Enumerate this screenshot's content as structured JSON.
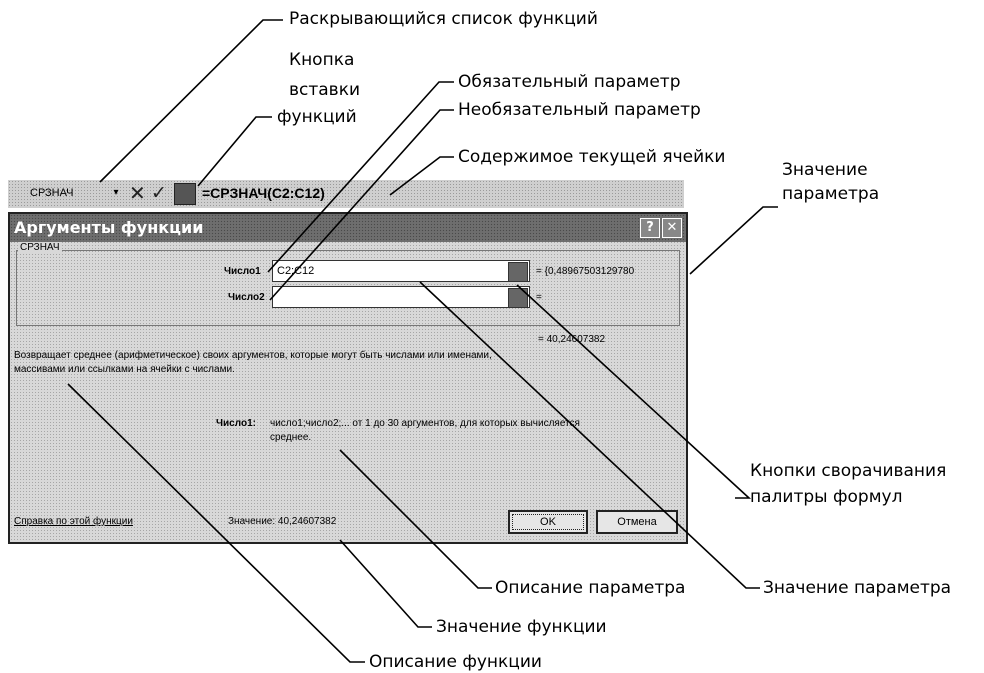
{
  "annotations": {
    "function_list": "Раскрывающийся список функций",
    "insert_button_l1": "Кнопка",
    "insert_button_l2": "вставки",
    "insert_button_l3": "функций",
    "required_param": "Обязательный параметр",
    "optional_param": "Необязательный параметр",
    "cell_contents": "Содержимое текущей ячейки",
    "param_value_top_l1": "Значение",
    "param_value_top_l2": "параметра",
    "collapse_buttons_l1": "Кнопки сворачивания",
    "collapse_buttons_l2": "палитры формул",
    "param_description": "Описание параметра",
    "param_value_bottom": "Значение параметра",
    "function_value": "Значение функции",
    "function_description": "Описание функции"
  },
  "formula_bar": {
    "name_box": "СРЗНАЧ",
    "dropdown_glyph": "▾",
    "cancel_glyph": "✕",
    "enter_glyph": "✓",
    "formula": "=СРЗНАЧ(C2:C12)"
  },
  "dialog": {
    "title": "Аргументы функции",
    "help_glyph": "?",
    "close_glyph": "✕",
    "group_label": "СРЗНАЧ",
    "arg1_label": "Число1",
    "arg1_value": "C2:C12",
    "arg1_result": "= {0,48967503129780",
    "arg2_label": "Число2",
    "arg2_value": "",
    "arg2_result": "=",
    "formula_result": "= 40,24607382",
    "description_l1": "Возвращает среднее (арифметическое) своих аргументов, которые могут быть числами или именами,",
    "description_l2": "массивами или ссылками на ячейки с числами.",
    "param_desc_label": "Число1:",
    "param_desc_l1": "число1;число2;... от 1 до 30 аргументов, для которых вычисляется",
    "param_desc_l2": "среднее.",
    "help_link": "Справка по этой функции",
    "value_line": "Значение: 40,24607382",
    "ok_label": "OK",
    "cancel_label": "Отмена"
  },
  "colors": {
    "dialog_bg": "#d8d8d8",
    "titlebar": "#6e6e6e",
    "input_bg": "#ffffff"
  }
}
